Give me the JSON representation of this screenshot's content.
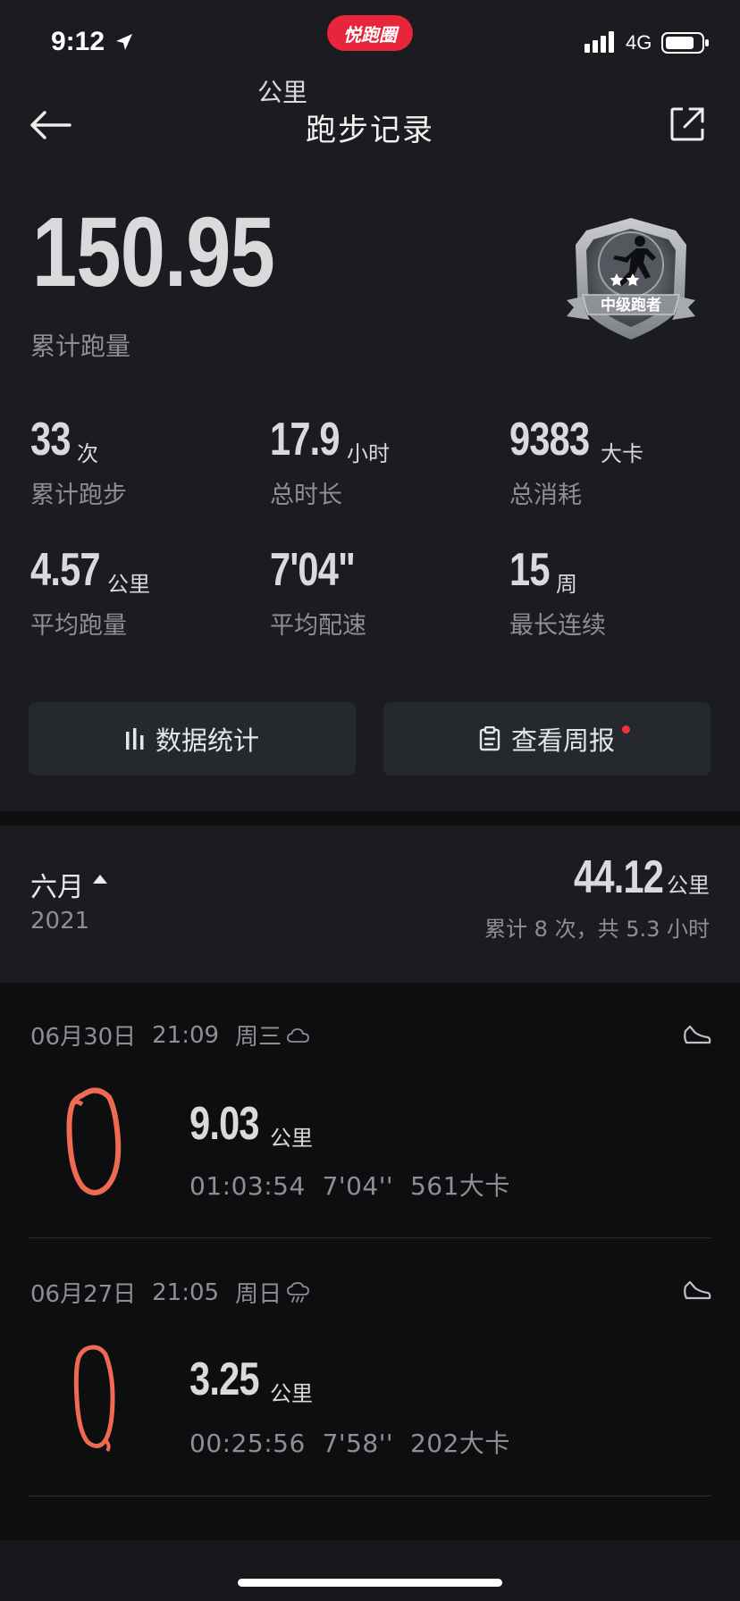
{
  "status_bar": {
    "time": "9:12",
    "network": "4G",
    "brand": "悦跑圈"
  },
  "nav": {
    "title": "跑步记录"
  },
  "total": {
    "value": "150.95",
    "unit": "公里",
    "label": "累计跑量"
  },
  "badge": {
    "label": "中级跑者",
    "stars": 2
  },
  "stats": [
    {
      "value": "33",
      "unit": "次",
      "label": "累计跑步"
    },
    {
      "value": "17.9",
      "unit": "小时",
      "label": "总时长"
    },
    {
      "value": "9383",
      "unit": "大卡",
      "label": "总消耗"
    },
    {
      "value": "4.57",
      "unit": "公里",
      "label": "平均跑量"
    },
    {
      "value": "7'04\"",
      "unit": "",
      "label": "平均配速"
    },
    {
      "value": "15",
      "unit": "周",
      "label": "最长连续"
    }
  ],
  "actions": {
    "stats_label": "数据统计",
    "weekly_label": "查看周报"
  },
  "month": {
    "name": "六月",
    "year": "2021",
    "distance": "44.12",
    "unit": "公里",
    "summary": "累计 8 次，共 5.3 小时"
  },
  "runs": [
    {
      "date": "06月30日",
      "time": "21:09",
      "weekday": "周三",
      "weather": "cloud-icon",
      "distance": "9.03",
      "unit": "公里",
      "duration": "01:03:54",
      "pace": "7'04''",
      "calories": "561大卡"
    },
    {
      "date": "06月27日",
      "time": "21:05",
      "weekday": "周日",
      "weather": "rain-icon",
      "distance": "3.25",
      "unit": "公里",
      "duration": "00:25:56",
      "pace": "7'58''",
      "calories": "202大卡"
    }
  ],
  "colors": {
    "background": "#0d0e10",
    "panel": "#1a1c20",
    "button": "#25282d",
    "route": "#ee6a52",
    "brand": "#e8253a",
    "notification": "#f2343a"
  }
}
